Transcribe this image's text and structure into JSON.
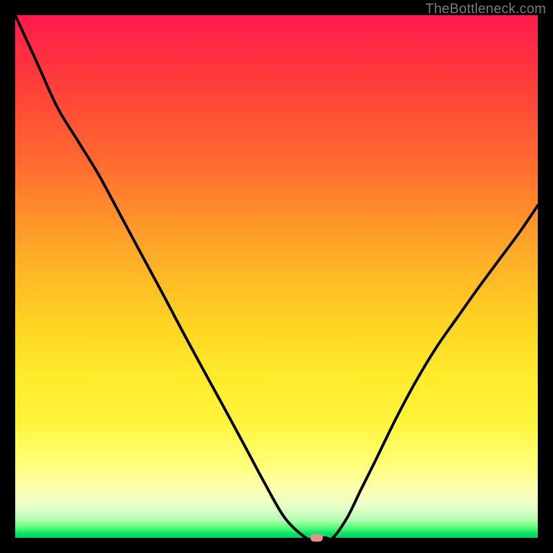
{
  "watermark": "TheBottleneck.com",
  "colors": {
    "frame": "#000000",
    "curve": "#000000",
    "marker": "#e89090"
  },
  "chart_data": {
    "type": "line",
    "title": "",
    "xlabel": "",
    "ylabel": "",
    "xlim": [
      0,
      100
    ],
    "ylim": [
      0,
      100
    ],
    "grid": false,
    "legend": false,
    "series": [
      {
        "name": "bottleneck-curve",
        "x": [
          0,
          4.0,
          8.0,
          11.9,
          15.9,
          19.9,
          23.8,
          27.8,
          31.7,
          35.7,
          39.7,
          43.7,
          47.6,
          51.6,
          55.6,
          56.9,
          58.2,
          59.5,
          60.8,
          63.5,
          66.1,
          68.8,
          72.8,
          76.7,
          80.7,
          84.7,
          88.6,
          92.6,
          96.6,
          100.0
        ],
        "y": [
          100.0,
          91.3,
          82.5,
          76.1,
          69.6,
          62.2,
          54.9,
          47.5,
          40.1,
          32.7,
          25.4,
          18.0,
          10.7,
          3.8,
          0.0,
          0.0,
          0.0,
          0.0,
          0.0,
          3.8,
          9.1,
          14.5,
          22.7,
          30.0,
          36.6,
          42.3,
          47.8,
          53.2,
          58.6,
          63.6
        ]
      }
    ],
    "markers": [
      {
        "name": "optimal-point",
        "x": 57.7,
        "y": 0.0
      }
    ]
  }
}
